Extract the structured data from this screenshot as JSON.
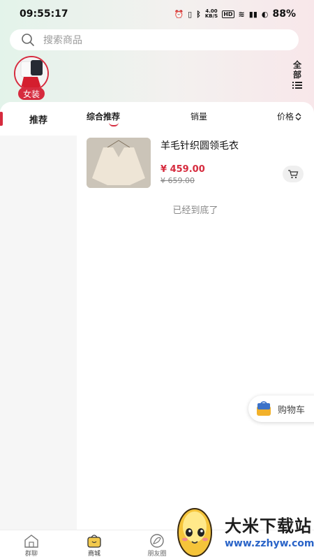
{
  "status_bar": {
    "time": "09:55:17",
    "net_speed": "4.00\nKB/S",
    "battery": "88%"
  },
  "search": {
    "placeholder": "搜索商品"
  },
  "category": {
    "label": "女装"
  },
  "all_button": {
    "line1": "全",
    "line2": "部"
  },
  "left_nav": {
    "active_tab": "推荐"
  },
  "sort_tabs": {
    "comprehensive": "综合推荐",
    "sales": "销量",
    "price": "价格"
  },
  "product": {
    "name": "羊毛针织圆领毛衣",
    "price": "¥ 459.00",
    "original_price": "¥ 659.00"
  },
  "end_message": "已经到底了",
  "float_cart": {
    "label": "购物车"
  },
  "bottom_nav": {
    "items": [
      {
        "label": "群聊"
      },
      {
        "label": "商城"
      },
      {
        "label": "朋友圈"
      }
    ]
  },
  "watermark": {
    "title": "大米下载站",
    "url": "www.zzhyw.com"
  },
  "colors": {
    "accent": "#d62b3e",
    "link": "#2a64c8"
  }
}
